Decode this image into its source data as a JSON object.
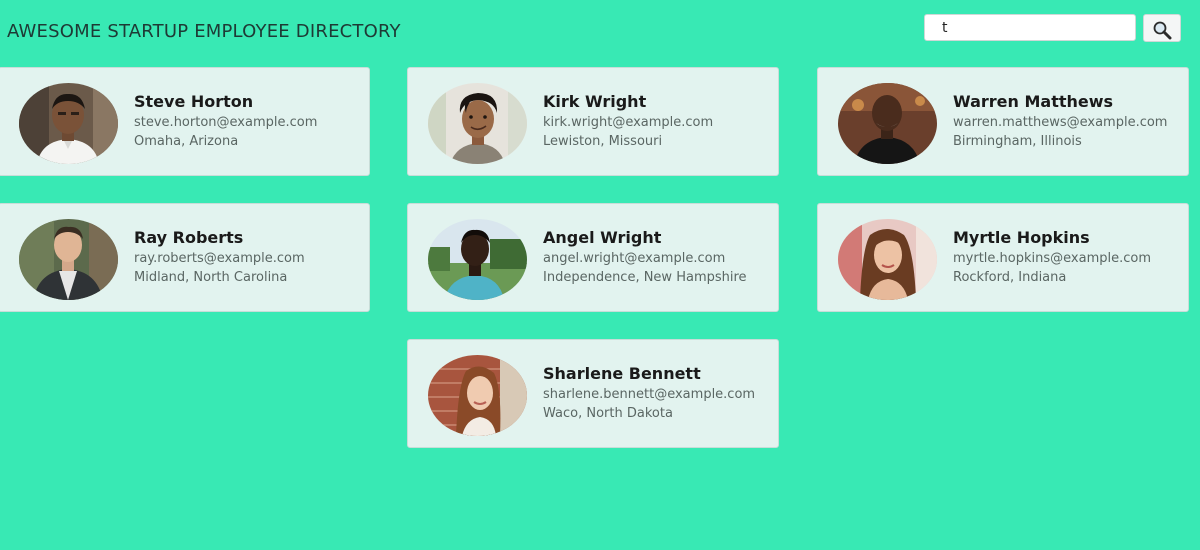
{
  "header": {
    "title": "AWESOME STARTUP EMPLOYEE DIRECTORY"
  },
  "search": {
    "value": "t",
    "button_icon": "magnifier-icon"
  },
  "employees": [
    {
      "name": "Steve Horton",
      "email": "steve.horton@example.com",
      "location": "Omaha, Arizona"
    },
    {
      "name": "Kirk Wright",
      "email": "kirk.wright@example.com",
      "location": "Lewiston, Missouri"
    },
    {
      "name": "Warren Matthews",
      "email": "warren.matthews@example.com",
      "location": "Birmingham, Illinois"
    },
    {
      "name": "Ray Roberts",
      "email": "ray.roberts@example.com",
      "location": "Midland, North Carolina"
    },
    {
      "name": "Angel Wright",
      "email": "angel.wright@example.com",
      "location": "Independence, New Hampshire"
    },
    {
      "name": "Myrtle Hopkins",
      "email": "myrtle.hopkins@example.com",
      "location": "Rockford, Indiana"
    },
    {
      "name": "Sharlene Bennett",
      "email": "sharlene.bennett@example.com",
      "location": "Waco, North Dakota"
    }
  ],
  "colors": {
    "background": "#38e9b4",
    "card": "#e2f3ef"
  }
}
